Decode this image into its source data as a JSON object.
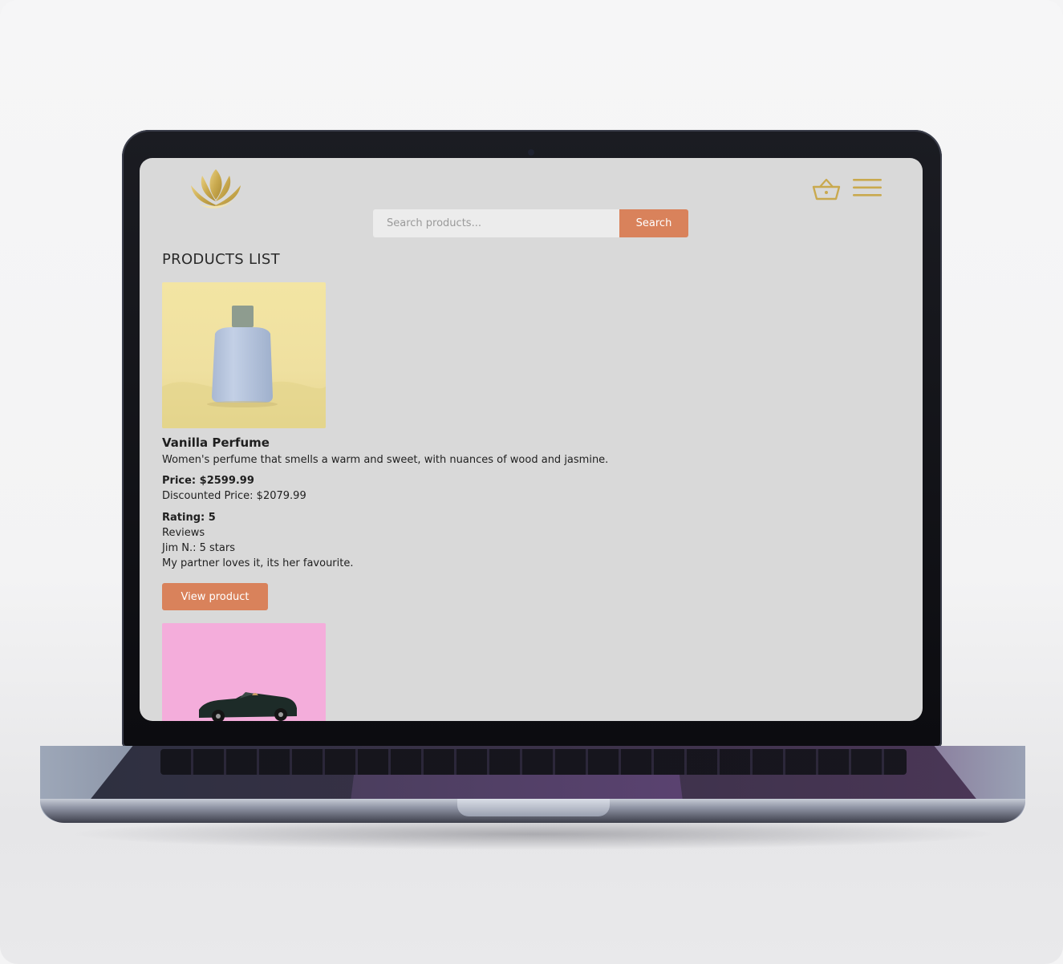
{
  "header": {
    "logo": "lotus-logo",
    "cart_icon": "basket-icon",
    "menu_icon": "hamburger-menu-icon"
  },
  "search": {
    "placeholder": "Search products...",
    "value": "",
    "button_label": "Search"
  },
  "page": {
    "title": "PRODUCTS LIST"
  },
  "products": [
    {
      "name": "Vanilla Perfume",
      "description": "Women's perfume that smells a warm and sweet, with nuances of wood and jasmine.",
      "price": "Price: $2599.99",
      "discounted_price": "Discounted Price: $2079.99",
      "rating": "Rating: 5",
      "reviews_heading": "Reviews",
      "review_author": "Jim N.: 5 stars",
      "review_text": "My partner loves it, its her favourite.",
      "button_label": "View product",
      "image": "perfume-bottle-photo"
    },
    {
      "image": "toy-car-photo"
    }
  ],
  "colors": {
    "accent": "#d9825b",
    "gold": "#c9a94e",
    "screen_bg": "#d9d9d9"
  }
}
